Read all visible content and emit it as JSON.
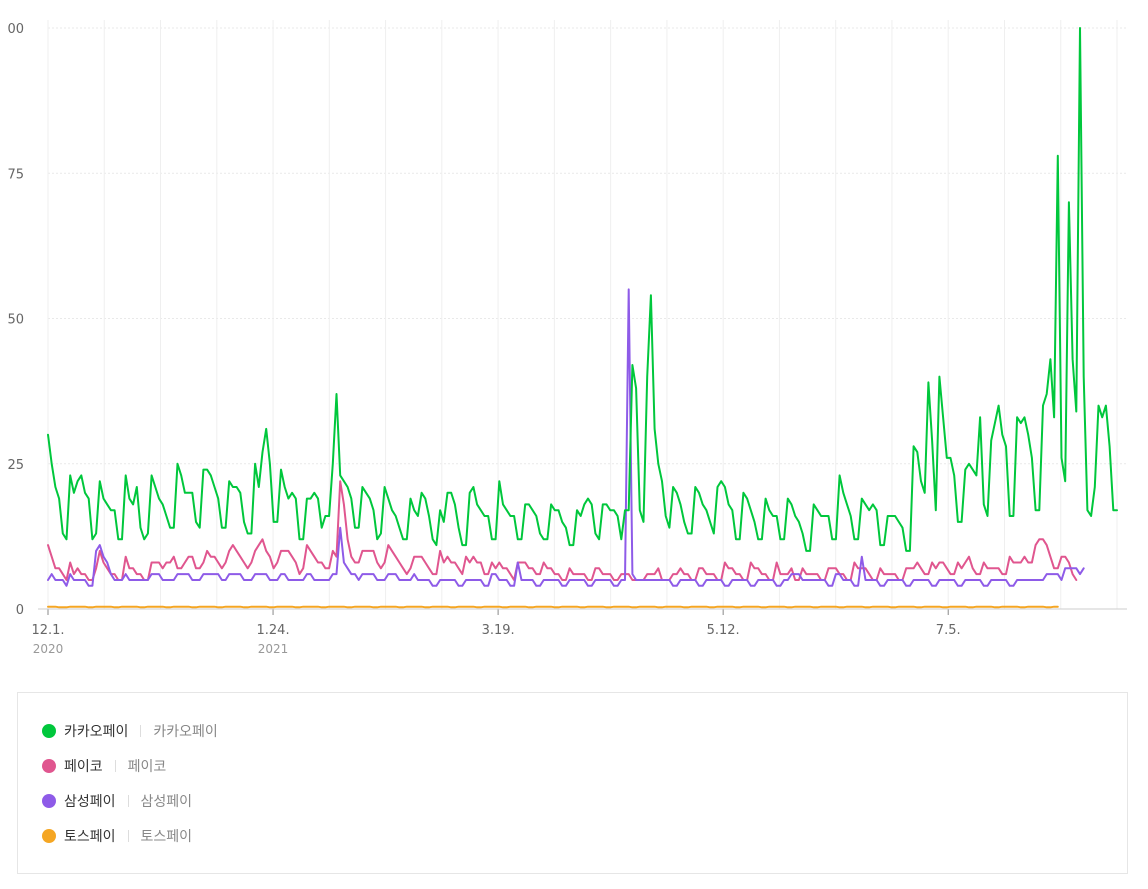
{
  "chart_data": {
    "type": "line",
    "ylim": [
      0,
      100
    ],
    "y_ticks": [
      "0",
      "25",
      "50",
      "75",
      "00"
    ],
    "x_ticks": [
      {
        "label": "12.1.",
        "year": "2020"
      },
      {
        "label": "1.24.",
        "year": "2021"
      },
      {
        "label": "3.19.",
        "year": ""
      },
      {
        "label": "5.12.",
        "year": ""
      },
      {
        "label": "7.5.",
        "year": ""
      }
    ],
    "series": [
      {
        "name": "카카오페이",
        "color": "#00c73c",
        "values": [
          30,
          25,
          21,
          19,
          13,
          12,
          23,
          20,
          22,
          23,
          20,
          19,
          12,
          13,
          22,
          19,
          18,
          17,
          17,
          12,
          12,
          23,
          19,
          18,
          21,
          14,
          12,
          13,
          23,
          21,
          19,
          18,
          16,
          14,
          14,
          25,
          23,
          20,
          20,
          20,
          15,
          14,
          24,
          24,
          23,
          21,
          19,
          14,
          14,
          22,
          21,
          21,
          20,
          15,
          13,
          13,
          25,
          21,
          27,
          31,
          25,
          15,
          15,
          24,
          21,
          19,
          20,
          19,
          12,
          12,
          19,
          19,
          20,
          19,
          14,
          16,
          16,
          25,
          37,
          23,
          22,
          21,
          19,
          14,
          14,
          21,
          20,
          19,
          17,
          12,
          13,
          21,
          19,
          17,
          16,
          14,
          12,
          12,
          19,
          17,
          16,
          20,
          19,
          16,
          12,
          11,
          17,
          15,
          20,
          20,
          18,
          14,
          11,
          11,
          20,
          21,
          18,
          17,
          16,
          16,
          12,
          12,
          22,
          18,
          17,
          16,
          16,
          12,
          12,
          18,
          18,
          17,
          16,
          13,
          12,
          12,
          18,
          17,
          17,
          15,
          14,
          11,
          11,
          17,
          16,
          18,
          19,
          18,
          13,
          12,
          18,
          18,
          17,
          17,
          16,
          12,
          17,
          17,
          42,
          38,
          17,
          15,
          40,
          54,
          31,
          25,
          22,
          16,
          14,
          21,
          20,
          18,
          15,
          13,
          13,
          21,
          20,
          18,
          17,
          15,
          13,
          21,
          22,
          21,
          18,
          17,
          12,
          12,
          20,
          19,
          17,
          15,
          12,
          12,
          19,
          17,
          16,
          16,
          12,
          12,
          19,
          18,
          16,
          15,
          13,
          10,
          10,
          18,
          17,
          16,
          16,
          16,
          12,
          12,
          23,
          20,
          18,
          16,
          12,
          12,
          19,
          18,
          17,
          18,
          17,
          11,
          11,
          16,
          16,
          16,
          15,
          14,
          10,
          10,
          28,
          27,
          22,
          20,
          39,
          29,
          17,
          40,
          33,
          26,
          26,
          23,
          15,
          15,
          24,
          25,
          24,
          23,
          33,
          18,
          16,
          29,
          32,
          35,
          30,
          28,
          16,
          16,
          33,
          32,
          33,
          30,
          26,
          17,
          17,
          35,
          37,
          43,
          33,
          78,
          26,
          22,
          70,
          43,
          34,
          100,
          40,
          17,
          16,
          21,
          35,
          33,
          35,
          28,
          17,
          17
        ]
      },
      {
        "name": "페이코",
        "color": "#e0568f",
        "values": [
          11,
          9,
          7,
          7,
          6,
          5,
          8,
          6,
          7,
          6,
          6,
          5,
          5,
          7,
          10,
          8,
          7,
          6,
          6,
          5,
          5,
          9,
          7,
          7,
          6,
          6,
          5,
          5,
          8,
          8,
          8,
          7,
          8,
          8,
          9,
          7,
          7,
          8,
          9,
          9,
          7,
          7,
          8,
          10,
          9,
          9,
          8,
          7,
          8,
          10,
          11,
          10,
          9,
          8,
          7,
          8,
          10,
          11,
          12,
          10,
          9,
          7,
          8,
          10,
          10,
          10,
          9,
          8,
          6,
          7,
          11,
          10,
          9,
          8,
          8,
          7,
          7,
          10,
          9,
          22,
          18,
          12,
          9,
          8,
          8,
          10,
          10,
          10,
          10,
          8,
          7,
          8,
          11,
          10,
          9,
          8,
          7,
          6,
          7,
          9,
          9,
          9,
          8,
          7,
          6,
          6,
          10,
          8,
          9,
          8,
          8,
          7,
          6,
          9,
          8,
          9,
          8,
          8,
          6,
          6,
          8,
          7,
          8,
          7,
          7,
          6,
          5,
          8,
          8,
          8,
          7,
          7,
          6,
          6,
          8,
          7,
          7,
          6,
          6,
          5,
          5,
          7,
          6,
          6,
          6,
          6,
          5,
          5,
          7,
          7,
          6,
          6,
          6,
          5,
          5,
          6,
          6,
          6,
          5,
          5,
          5,
          5,
          6,
          6,
          6,
          7,
          5,
          5,
          5,
          6,
          6,
          7,
          6,
          6,
          5,
          5,
          7,
          7,
          6,
          6,
          6,
          5,
          5,
          8,
          7,
          7,
          6,
          6,
          5,
          5,
          8,
          7,
          7,
          6,
          6,
          5,
          5,
          8,
          6,
          6,
          6,
          7,
          5,
          5,
          7,
          6,
          6,
          6,
          6,
          5,
          5,
          7,
          7,
          7,
          6,
          6,
          5,
          5,
          8,
          7,
          7,
          7,
          6,
          5,
          5,
          7,
          6,
          6,
          6,
          6,
          5,
          5,
          7,
          7,
          7,
          8,
          7,
          6,
          6,
          8,
          7,
          8,
          8,
          7,
          6,
          6,
          8,
          7,
          8,
          9,
          7,
          6,
          6,
          8,
          7,
          7,
          7,
          7,
          6,
          6,
          9,
          8,
          8,
          8,
          9,
          8,
          8,
          11,
          12,
          12,
          11,
          9,
          7,
          7,
          9,
          9,
          8,
          6,
          5
        ]
      },
      {
        "name": "삼성페이",
        "color": "#8e5be8",
        "values": [
          5,
          6,
          5,
          5,
          5,
          4,
          6,
          5,
          5,
          5,
          5,
          4,
          4,
          10,
          11,
          9,
          8,
          6,
          5,
          5,
          5,
          6,
          5,
          5,
          5,
          5,
          5,
          5,
          6,
          6,
          6,
          5,
          5,
          5,
          5,
          6,
          6,
          6,
          6,
          5,
          5,
          5,
          6,
          6,
          6,
          6,
          6,
          5,
          5,
          6,
          6,
          6,
          6,
          5,
          5,
          5,
          6,
          6,
          6,
          6,
          5,
          5,
          5,
          6,
          6,
          5,
          5,
          5,
          5,
          5,
          6,
          6,
          5,
          5,
          5,
          5,
          5,
          6,
          6,
          14,
          8,
          7,
          6,
          6,
          5,
          6,
          6,
          6,
          6,
          5,
          5,
          5,
          6,
          6,
          6,
          5,
          5,
          5,
          5,
          6,
          5,
          5,
          5,
          5,
          4,
          4,
          5,
          5,
          5,
          5,
          5,
          4,
          4,
          5,
          5,
          5,
          5,
          5,
          4,
          4,
          6,
          6,
          5,
          5,
          5,
          4,
          4,
          8,
          5,
          5,
          5,
          5,
          4,
          4,
          5,
          5,
          5,
          5,
          5,
          4,
          4,
          5,
          5,
          5,
          5,
          5,
          4,
          4,
          5,
          5,
          5,
          5,
          5,
          4,
          4,
          5,
          5,
          55,
          6,
          5,
          5,
          5,
          5,
          5,
          5,
          5,
          5,
          5,
          5,
          4,
          4,
          5,
          5,
          5,
          5,
          5,
          4,
          4,
          5,
          5,
          5,
          5,
          5,
          4,
          4,
          5,
          5,
          5,
          5,
          5,
          4,
          4,
          5,
          5,
          5,
          5,
          5,
          4,
          4,
          5,
          5,
          6,
          6,
          6,
          5,
          5,
          5,
          5,
          5,
          5,
          5,
          4,
          4,
          6,
          6,
          5,
          5,
          5,
          4,
          4,
          9,
          5,
          5,
          5,
          5,
          4,
          4,
          5,
          5,
          5,
          5,
          5,
          4,
          4,
          5,
          5,
          5,
          5,
          5,
          4,
          4,
          5,
          5,
          5,
          5,
          5,
          4,
          4,
          5,
          5,
          5,
          5,
          5,
          4,
          4,
          5,
          5,
          5,
          5,
          5,
          4,
          4,
          5,
          5,
          5,
          5,
          5,
          5,
          5,
          5,
          6,
          6,
          6,
          6,
          5,
          7,
          7,
          7,
          7,
          6,
          7
        ]
      },
      {
        "name": "토스페이",
        "color": "#f5a623",
        "values": [
          0.4,
          0.4,
          0.4,
          0.3,
          0.3,
          0.3,
          0.4,
          0.4,
          0.4,
          0.4,
          0.4,
          0.3,
          0.3,
          0.4,
          0.4,
          0.4,
          0.4,
          0.4,
          0.3,
          0.3,
          0.4,
          0.4,
          0.4,
          0.4,
          0.4,
          0.3,
          0.3,
          0.4,
          0.4,
          0.4,
          0.4,
          0.4,
          0.3,
          0.3,
          0.4,
          0.4,
          0.4,
          0.4,
          0.4,
          0.3,
          0.3,
          0.4,
          0.4,
          0.4,
          0.4,
          0.4,
          0.3,
          0.3,
          0.4,
          0.4,
          0.4,
          0.4,
          0.4,
          0.3,
          0.3,
          0.4,
          0.4,
          0.4,
          0.4,
          0.4,
          0.3,
          0.3,
          0.4,
          0.4,
          0.4,
          0.4,
          0.4,
          0.3,
          0.3,
          0.4,
          0.4,
          0.4,
          0.4,
          0.4,
          0.3,
          0.3,
          0.4,
          0.4,
          0.4,
          0.4,
          0.4,
          0.3,
          0.3,
          0.4,
          0.4,
          0.4,
          0.4,
          0.4,
          0.3,
          0.3,
          0.4,
          0.4,
          0.4,
          0.4,
          0.4,
          0.3,
          0.3,
          0.4,
          0.4,
          0.4,
          0.4,
          0.4,
          0.3,
          0.3,
          0.4,
          0.4,
          0.4,
          0.4,
          0.4,
          0.3,
          0.3,
          0.4,
          0.4,
          0.4,
          0.4,
          0.4,
          0.3,
          0.3,
          0.4,
          0.4,
          0.4,
          0.4,
          0.4,
          0.3,
          0.3,
          0.4,
          0.4,
          0.4,
          0.4,
          0.4,
          0.3,
          0.3,
          0.4,
          0.4,
          0.4,
          0.4,
          0.4,
          0.3,
          0.3,
          0.4,
          0.4,
          0.4,
          0.4,
          0.4,
          0.3,
          0.3,
          0.4,
          0.4,
          0.4,
          0.4,
          0.4,
          0.3,
          0.3,
          0.4,
          0.4,
          0.4,
          0.4,
          0.4,
          0.3,
          0.3,
          0.4,
          0.4,
          0.4,
          0.4,
          0.4,
          0.3,
          0.3,
          0.4,
          0.4,
          0.4,
          0.4,
          0.4,
          0.3,
          0.3,
          0.4,
          0.4,
          0.4,
          0.4,
          0.4,
          0.3,
          0.3,
          0.4,
          0.4,
          0.4,
          0.4,
          0.4,
          0.3,
          0.3,
          0.4,
          0.4,
          0.4,
          0.4,
          0.4,
          0.3,
          0.3,
          0.4,
          0.4,
          0.4,
          0.4,
          0.4,
          0.3,
          0.3,
          0.4,
          0.4,
          0.4,
          0.4,
          0.4,
          0.3,
          0.3,
          0.4,
          0.4,
          0.4,
          0.4,
          0.4,
          0.3,
          0.3,
          0.4,
          0.4,
          0.4,
          0.4,
          0.4,
          0.3,
          0.3,
          0.4,
          0.4,
          0.4,
          0.4,
          0.4,
          0.3,
          0.3,
          0.4,
          0.4,
          0.4,
          0.4,
          0.4,
          0.3,
          0.3,
          0.4,
          0.4,
          0.4,
          0.4,
          0.4,
          0.3,
          0.3,
          0.4,
          0.4,
          0.4,
          0.4,
          0.4,
          0.3,
          0.3,
          0.4,
          0.4,
          0.4,
          0.4,
          0.4,
          0.3,
          0.3,
          0.4,
          0.4,
          0.4,
          0.4,
          0.4,
          0.3,
          0.3,
          0.4,
          0.4,
          0.4,
          0.4,
          0.4,
          0.3,
          0.3,
          0.4,
          0.4
        ]
      }
    ]
  },
  "legend": {
    "items": [
      {
        "name": "카카오페이",
        "keyword": "카카오페이",
        "color": "#00c73c"
      },
      {
        "name": "페이코",
        "keyword": "페이코",
        "color": "#e0568f"
      },
      {
        "name": "삼성페이",
        "keyword": "삼성페이",
        "color": "#8e5be8"
      },
      {
        "name": "토스페이",
        "keyword": "토스페이",
        "color": "#f5a623"
      }
    ]
  }
}
